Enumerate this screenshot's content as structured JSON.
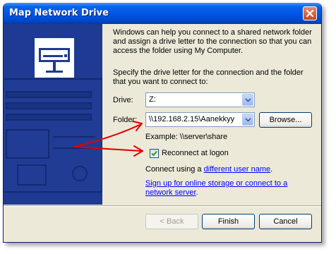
{
  "window": {
    "title": "Map Network Drive"
  },
  "intro_text": [
    "Windows can help you connect to a shared network folder",
    "and assign a drive letter to the connection so that you can",
    "access the folder using My Computer."
  ],
  "specify_text": [
    "Specify the drive letter for the connection and the folder",
    "that you want to connect to:"
  ],
  "drive": {
    "label": "Drive:",
    "value": "Z:"
  },
  "folder": {
    "label": "Folder:",
    "value": "\\\\192.168.2.15\\Aanekkyy"
  },
  "browse_label": "Browse...",
  "example_text": "Example: \\\\server\\share",
  "reconnect": {
    "label": "Reconnect at logon",
    "checked": true
  },
  "connect_using": {
    "prefix": "Connect using a ",
    "link": "different user name",
    "suffix": "."
  },
  "signup": {
    "line1": "Sign up for online storage or connect to a",
    "line2": "network server",
    "suffix": "."
  },
  "buttons": {
    "back": "< Back",
    "finish": "Finish",
    "cancel": "Cancel"
  },
  "icons": [
    "close-icon",
    "network-drive-icon",
    "dropdown-arrow-icon",
    "checkmark-icon",
    "red-arrow"
  ],
  "colors": {
    "titlebar": "#0055e5",
    "panel": "#1e3a92",
    "dialog": "#ece9d8",
    "link": "#0000ff",
    "arrow": "#e00000"
  }
}
